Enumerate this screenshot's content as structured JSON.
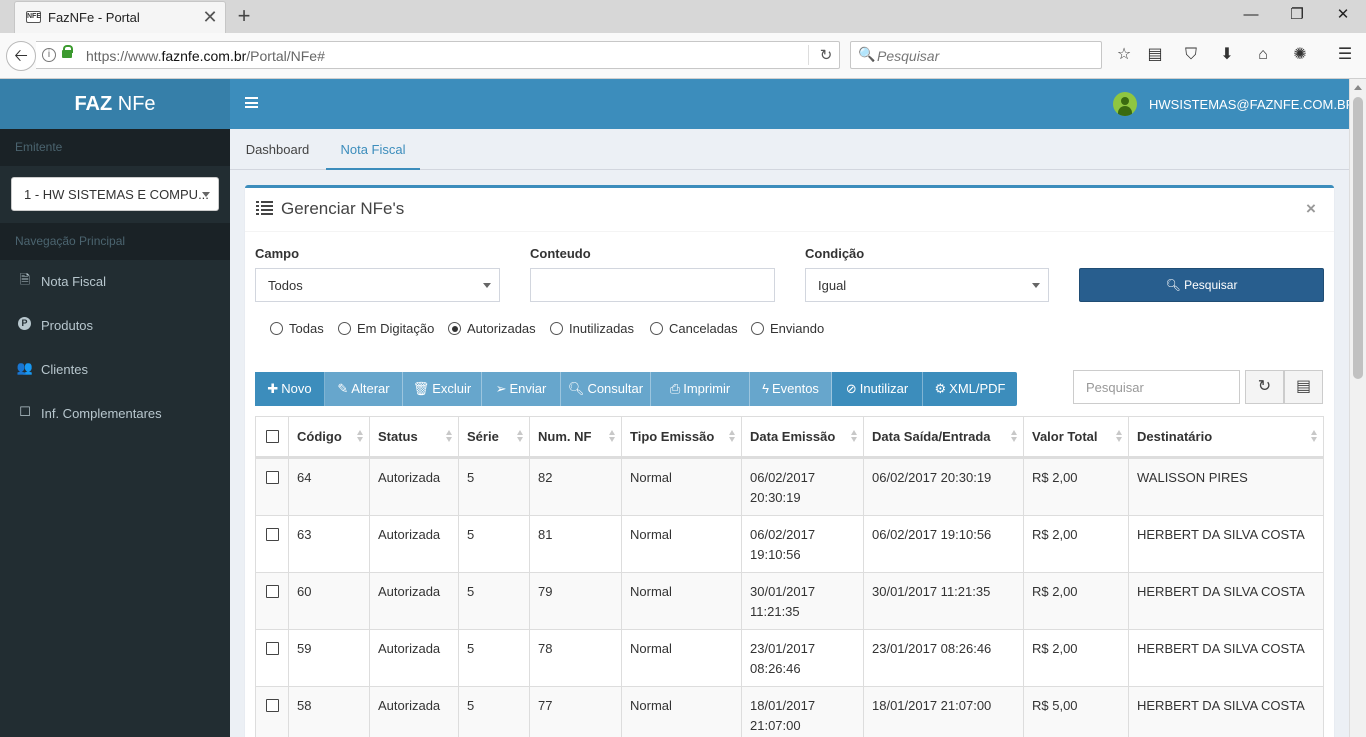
{
  "browser": {
    "tab_title": "FazNFe - Portal",
    "favicon_text": "NFE",
    "url_domain": "faznfe.com.br",
    "url_prefix": "https://www.",
    "url_path": "/Portal/NFe#",
    "search_placeholder": "Pesquisar"
  },
  "sidebar": {
    "brand_bold": "FAZ",
    "brand_rest": " NFe",
    "emitente_header": "Emitente",
    "emitente_value": "1 - HW SISTEMAS E COMPU...",
    "nav_header": "Navegação Principal",
    "items": [
      {
        "label": "Nota Fiscal",
        "icon": "file-icon"
      },
      {
        "label": "Produtos",
        "icon": "product-icon"
      },
      {
        "label": "Clientes",
        "icon": "users-icon"
      },
      {
        "label": "Inf. Complementares",
        "icon": "note-icon"
      }
    ]
  },
  "header": {
    "user_email": "HWSISTEMAS@FAZNFE.COM.BR"
  },
  "tabs": [
    {
      "label": "Dashboard"
    },
    {
      "label": "Nota Fiscal"
    }
  ],
  "box": {
    "title": "Gerenciar NFe's",
    "close": "×",
    "filters": {
      "campo_label": "Campo",
      "campo_value": "Todos",
      "conteudo_label": "Conteudo",
      "conteudo_value": "",
      "condicao_label": "Condição",
      "condicao_value": "Igual",
      "search_button": "Pesquisar"
    },
    "radios": [
      {
        "label": "Todas",
        "checked": false
      },
      {
        "label": "Em Digitação",
        "checked": false
      },
      {
        "label": "Autorizadas",
        "checked": true
      },
      {
        "label": "Inutilizadas",
        "checked": false
      },
      {
        "label": "Canceladas",
        "checked": false
      },
      {
        "label": "Enviando",
        "checked": false
      }
    ],
    "toolbar": {
      "novo": "Novo",
      "alterar": "Alterar",
      "excluir": "Excluir",
      "enviar": "Enviar",
      "consultar": "Consultar",
      "imprimir": "Imprimir",
      "eventos": "Eventos",
      "inutilizar": "Inutilizar",
      "xml_pdf": "XML/PDF",
      "search_placeholder": "Pesquisar"
    },
    "colors": {
      "primary": "#3c8dbc",
      "light": "#67a6cc",
      "dark": "#285e8e"
    },
    "columns": [
      "Código",
      "Status",
      "Série",
      "Num. NF",
      "Tipo Emissão",
      "Data Emissão",
      "Data Saída/Entrada",
      "Valor Total",
      "Destinatário"
    ],
    "rows": [
      {
        "codigo": "64",
        "status": "Autorizada",
        "serie": "5",
        "num_nf": "82",
        "tipo": "Normal",
        "data_emissao_d": "06/02/2017",
        "data_emissao_t": "20:30:19",
        "data_saida": "06/02/2017 20:30:19",
        "valor": "R$ 2,00",
        "destinatario": "WALISSON PIRES"
      },
      {
        "codigo": "63",
        "status": "Autorizada",
        "serie": "5",
        "num_nf": "81",
        "tipo": "Normal",
        "data_emissao_d": "06/02/2017",
        "data_emissao_t": "19:10:56",
        "data_saida": "06/02/2017 19:10:56",
        "valor": "R$ 2,00",
        "destinatario": "HERBERT DA SILVA COSTA"
      },
      {
        "codigo": "60",
        "status": "Autorizada",
        "serie": "5",
        "num_nf": "79",
        "tipo": "Normal",
        "data_emissao_d": "30/01/2017",
        "data_emissao_t": "11:21:35",
        "data_saida": "30/01/2017 11:21:35",
        "valor": "R$ 2,00",
        "destinatario": "HERBERT DA SILVA COSTA"
      },
      {
        "codigo": "59",
        "status": "Autorizada",
        "serie": "5",
        "num_nf": "78",
        "tipo": "Normal",
        "data_emissao_d": "23/01/2017",
        "data_emissao_t": "08:26:46",
        "data_saida": "23/01/2017 08:26:46",
        "valor": "R$ 2,00",
        "destinatario": "HERBERT DA SILVA COSTA"
      },
      {
        "codigo": "58",
        "status": "Autorizada",
        "serie": "5",
        "num_nf": "77",
        "tipo": "Normal",
        "data_emissao_d": "18/01/2017",
        "data_emissao_t": "21:07:00",
        "data_saida": "18/01/2017 21:07:00",
        "valor": "R$ 5,00",
        "destinatario": "HERBERT DA SILVA COSTA"
      }
    ]
  }
}
